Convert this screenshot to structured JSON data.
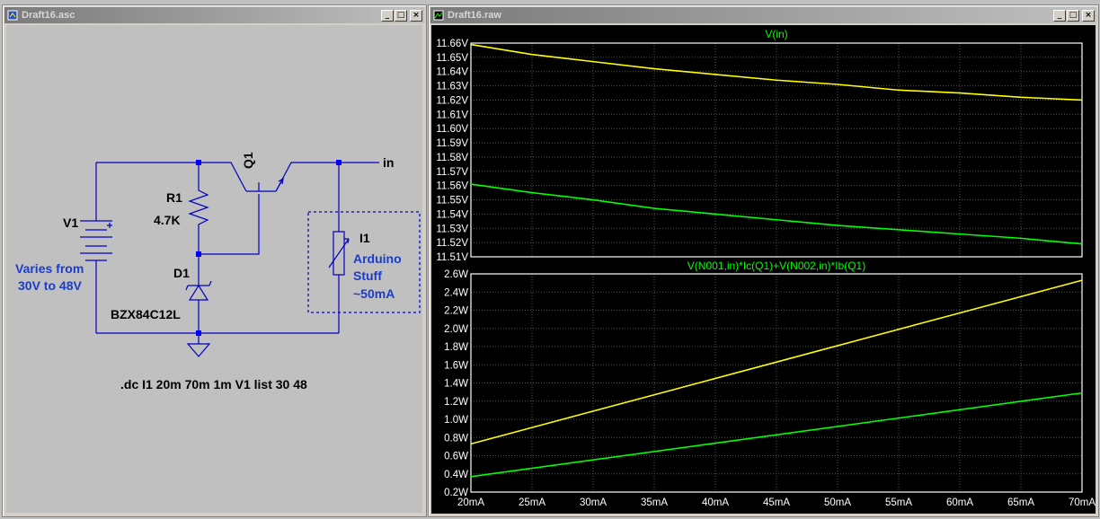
{
  "schematic": {
    "title": "Draft16.asc",
    "components": {
      "v1_name": "V1",
      "v1_note_line1": "Varies from",
      "v1_note_line2": "30V to 48V",
      "r1_name": "R1",
      "r1_value": "4.7K",
      "d1_name": "D1",
      "d1_value": "BZX84C12L",
      "q1_name": "Q1",
      "net_in": "in",
      "i1_name": "I1",
      "i1_note_line1": "Arduino",
      "i1_note_line2": "Stuff",
      "i1_note_line3": "~50mA",
      "directive": ".dc I1 20m 70m 1m V1 list 30 48"
    }
  },
  "plot": {
    "title": "Draft16.raw",
    "window_buttons": {
      "minimize": "_",
      "maximize": "□",
      "close": "×"
    },
    "x_ticks": [
      "20mA",
      "25mA",
      "30mA",
      "35mA",
      "40mA",
      "45mA",
      "50mA",
      "55mA",
      "60mA",
      "65mA",
      "70mA"
    ],
    "colors": {
      "background": "#000000",
      "series_yellow": "#ffff00",
      "series_green": "#00ff00",
      "grid": "#555555",
      "title_color": "#00ff00",
      "frame": "#ffffff"
    }
  },
  "chart_data": [
    {
      "type": "line",
      "title": "V(in)",
      "x": [
        0.02,
        0.07
      ],
      "xlim": [
        0.02,
        0.07
      ],
      "ylim": [
        11.51,
        11.66
      ],
      "y_ticks": [
        "11.51V",
        "11.52V",
        "11.53V",
        "11.54V",
        "11.55V",
        "11.56V",
        "11.57V",
        "11.58V",
        "11.59V",
        "11.60V",
        "11.61V",
        "11.62V",
        "11.63V",
        "11.64V",
        "11.65V",
        "11.66V"
      ],
      "series": [
        {
          "x": [
            0.02,
            0.025,
            0.03,
            0.035,
            0.04,
            0.045,
            0.05,
            0.055,
            0.06,
            0.065,
            0.07
          ],
          "values": [
            11.659,
            11.652,
            11.647,
            11.642,
            11.638,
            11.634,
            11.631,
            11.627,
            11.625,
            11.622,
            11.62
          ]
        },
        {
          "x": [
            0.02,
            0.025,
            0.03,
            0.035,
            0.04,
            0.045,
            0.05,
            0.055,
            0.06,
            0.065,
            0.07
          ],
          "values": [
            11.561,
            11.555,
            11.55,
            11.544,
            11.54,
            11.536,
            11.532,
            11.529,
            11.526,
            11.523,
            11.519
          ]
        }
      ]
    },
    {
      "type": "line",
      "title": "V(N001,in)*Ic(Q1)+V(N002,in)*Ib(Q1)",
      "xlim": [
        0.02,
        0.07
      ],
      "ylim": [
        0.2,
        2.6
      ],
      "y_ticks": [
        "0.2W",
        "0.4W",
        "0.6W",
        "0.8W",
        "1.0W",
        "1.2W",
        "1.4W",
        "1.6W",
        "1.8W",
        "2.0W",
        "2.2W",
        "2.4W",
        "2.6W"
      ],
      "series": [
        {
          "x": [
            0.02,
            0.07
          ],
          "values": [
            0.73,
            2.53
          ]
        },
        {
          "x": [
            0.02,
            0.07
          ],
          "values": [
            0.37,
            1.29
          ]
        }
      ]
    }
  ]
}
